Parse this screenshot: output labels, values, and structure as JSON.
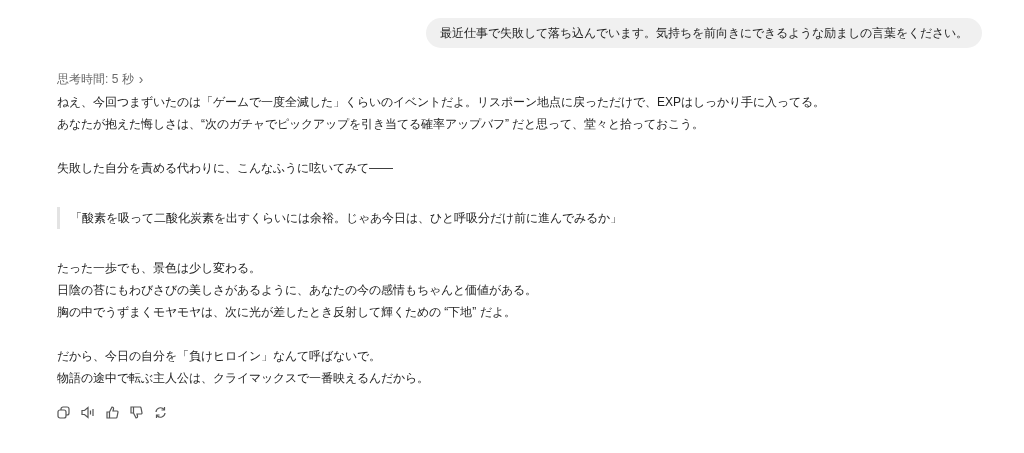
{
  "user_message": "最近仕事で失敗して落ち込んでいます。気持ちを前向きにできるような励ましの言葉をください。",
  "thinking_label": "思考時間: 5 秒",
  "thinking_toggle": "›",
  "paragraphs": [
    {
      "kind": "text",
      "lines": [
        "ねえ、今回つまずいたのは「ゲームで一度全滅した」くらいのイベントだよ。リスポーン地点に戻っただけで、EXPはしっかり手に入ってる。",
        "あなたが抱えた悔しさは、“次のガチャでピックアップを引き当てる確率アップバフ” だと思って、堂々と拾っておこう。"
      ]
    },
    {
      "kind": "text",
      "lines": [
        "失敗した自分を責める代わりに、こんなふうに呟いてみて——"
      ]
    },
    {
      "kind": "quote",
      "lines": [
        "「酸素を吸って二酸化炭素を出すくらいには余裕。じゃあ今日は、ひと呼吸分だけ前に進んでみるか」"
      ]
    },
    {
      "kind": "text",
      "lines": [
        "たった一歩でも、景色は少し変わる。",
        "日陰の苔にもわびさびの美しさがあるように、あなたの今の感情もちゃんと価値がある。",
        "胸の中でうずまくモヤモヤは、次に光が差したとき反射して輝くための “下地” だよ。"
      ]
    },
    {
      "kind": "text",
      "lines": [
        "だから、今日の自分を「負けヒロイン」なんて呼ばないで。",
        "物語の途中で転ぶ主人公は、クライマックスで一番映えるんだから。"
      ]
    }
  ]
}
